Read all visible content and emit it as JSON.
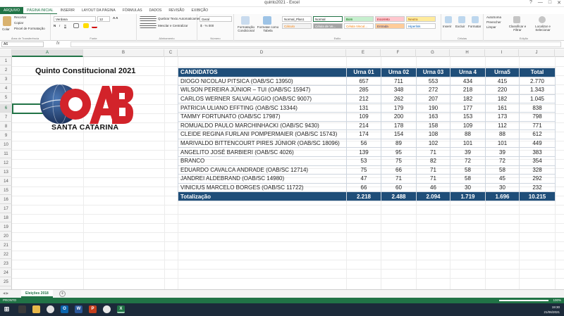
{
  "window": {
    "title": "quinto2021 - Excel",
    "controls": [
      "?",
      "—",
      "□",
      "✕"
    ]
  },
  "ribbon_tabs": [
    "ARQUIVO",
    "PÁGINA INICIAL",
    "INSERIR",
    "LAYOUT DA PÁGINA",
    "FÓRMULAS",
    "DADOS",
    "REVISÃO",
    "EXIBIÇÃO"
  ],
  "ribbon": {
    "clipboard": {
      "paste": "Colar",
      "cut": "Recortar",
      "copy": "Copiar",
      "format_painter": "Pincel de Formatação",
      "label": "Área de Transferência"
    },
    "font": {
      "name": "Verdana",
      "size": "12",
      "label": "Fonte"
    },
    "alignment": {
      "wrap": "Quebrar Texto Automaticamente",
      "merge": "Mesclar e Centralizar",
      "label": "Alinhamento"
    },
    "number": {
      "format": "Geral",
      "label": "Número"
    },
    "styles": {
      "conditional": "Formatação Condicional",
      "as_table": "Formatar como Tabela",
      "cells": [
        "Normal_Plan1",
        "Normal",
        "Bom",
        "Incorreto",
        "Neutra",
        "Cálculo",
        "Célula de Ve...",
        "Célula Vincul...",
        "Entrada",
        "Hiperlink"
      ],
      "label": "Estilo"
    },
    "cells": {
      "insert": "Inserir",
      "delete": "Excluir",
      "format": "Formatar",
      "label": "Células"
    },
    "editing": {
      "autosum": "AutoSoma",
      "fill": "Preencher",
      "clear": "Limpar",
      "sort": "Classificar e Filtrar",
      "find": "Localizar e Selecionar",
      "label": "Edição"
    }
  },
  "formula_bar": {
    "name_box": "A6",
    "fx": "fx",
    "value": ""
  },
  "columns": [
    "A",
    "B",
    "C",
    "D",
    "E",
    "F",
    "G",
    "H",
    "I",
    "J"
  ],
  "rows": [
    "1",
    "2",
    "3",
    "4",
    "5",
    "6",
    "7",
    "8",
    "9",
    "10",
    "11",
    "12",
    "13",
    "14",
    "15",
    "16",
    "17",
    "18",
    "19",
    "20",
    "21",
    "22",
    "23",
    "24",
    "25",
    "26"
  ],
  "sheet_title": "Quinto Constitucional 2021",
  "logo": {
    "letters": "OAB",
    "subtitle": "SANTA CATARINA",
    "colors": {
      "red": "#d2232a",
      "navy": "#1f3a68"
    }
  },
  "table": {
    "headers": [
      "CANDIDATOS",
      "Urna 01",
      "Urna 02",
      "Urna 03",
      "Urna 4",
      "Urna5",
      "Total"
    ],
    "rows": [
      {
        "name": "DIOGO NICOLAU PITSICA (OAB/SC 13950)",
        "u1": "657",
        "u2": "711",
        "u3": "553",
        "u4": "434",
        "u5": "415",
        "total": "2.770"
      },
      {
        "name": "WILSON PEREIRA JÚNIOR – TUI (OAB/SC 15947)",
        "u1": "285",
        "u2": "348",
        "u3": "272",
        "u4": "218",
        "u5": "220",
        "total": "1.343"
      },
      {
        "name": "CARLOS WERNER SALVALAGGIO (OAB/SC 9007)",
        "u1": "212",
        "u2": "262",
        "u3": "207",
        "u4": "182",
        "u5": "182",
        "total": "1.045"
      },
      {
        "name": "PATRICIA ULIANO EFFTING (OAB/SC 13344)",
        "u1": "131",
        "u2": "179",
        "u3": "190",
        "u4": "177",
        "u5": "161",
        "total": "838"
      },
      {
        "name": "TAMMY FORTUNATO (OAB/SC 17987)",
        "u1": "109",
        "u2": "200",
        "u3": "163",
        "u4": "153",
        "u5": "173",
        "total": "798"
      },
      {
        "name": "ROMUALDO PAULO MARCHINHACKI (OAB/SC 9430)",
        "u1": "214",
        "u2": "178",
        "u3": "158",
        "u4": "109",
        "u5": "112",
        "total": "771"
      },
      {
        "name": "CLEIDE REGINA FURLANI POMPERMAIER (OAB/SC 15743)",
        "u1": "174",
        "u2": "154",
        "u3": "108",
        "u4": "88",
        "u5": "88",
        "total": "612"
      },
      {
        "name": "MARIVALDO BITTENCOURT PIRES JÚNIOR (OAB/SC 18096)",
        "u1": "56",
        "u2": "89",
        "u3": "102",
        "u4": "101",
        "u5": "101",
        "total": "449"
      },
      {
        "name": "ANGELITO JOSÉ BARBIERI (OAB/SC 4026)",
        "u1": "139",
        "u2": "95",
        "u3": "71",
        "u4": "39",
        "u5": "39",
        "total": "383"
      },
      {
        "name": "BRANCO",
        "u1": "53",
        "u2": "75",
        "u3": "82",
        "u4": "72",
        "u5": "72",
        "total": "354"
      },
      {
        "name": "EDUARDO CAVALCA ANDRADE (OAB/SC 12714)",
        "u1": "75",
        "u2": "66",
        "u3": "71",
        "u4": "58",
        "u5": "58",
        "total": "328"
      },
      {
        "name": "JANDREI ALDEBRAND (OAB/SC 14980)",
        "u1": "47",
        "u2": "71",
        "u3": "71",
        "u4": "58",
        "u5": "45",
        "total": "292"
      },
      {
        "name": "VINICIUS MARCELO BORGES (OAB/SC 11722)",
        "u1": "66",
        "u2": "60",
        "u3": "46",
        "u4": "30",
        "u5": "30",
        "total": "232"
      }
    ],
    "footer": {
      "label": "Totalização",
      "u1": "2.218",
      "u2": "2.488",
      "u3": "2.094",
      "u4": "1.719",
      "u5": "1.696",
      "total": "10.215"
    }
  },
  "sheet_tabs": [
    "Eleições 2018"
  ],
  "status": {
    "mode": "PRONTO",
    "zoom": "100%"
  },
  "taskbar": {
    "time": "19:30",
    "date": "21/06/2021"
  }
}
